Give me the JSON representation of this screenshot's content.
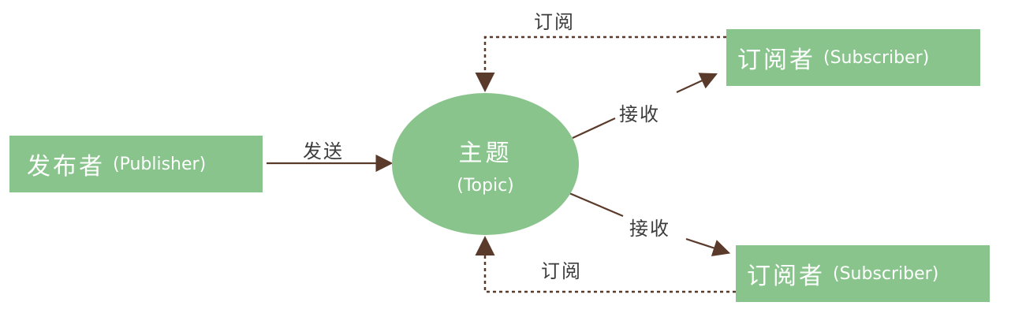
{
  "nodes": {
    "publisher": {
      "label_zh": "发布者",
      "label_en": "(Publisher)"
    },
    "topic": {
      "label_zh": "主题",
      "label_en": "(Topic)"
    },
    "subscriber_top": {
      "label_zh": "订阅者",
      "label_en": "(Subscriber)"
    },
    "subscriber_bottom": {
      "label_zh": "订阅者",
      "label_en": "(Subscriber)"
    }
  },
  "edges": {
    "send": "发送",
    "receive_top": "接收",
    "receive_bottom": "接收",
    "subscribe_top": "订阅",
    "subscribe_bottom": "订阅"
  },
  "colors": {
    "node_fill": "#89c48c",
    "node_text": "#ffffff",
    "line": "#5a3a2a",
    "label_text": "#3d3d3d"
  }
}
